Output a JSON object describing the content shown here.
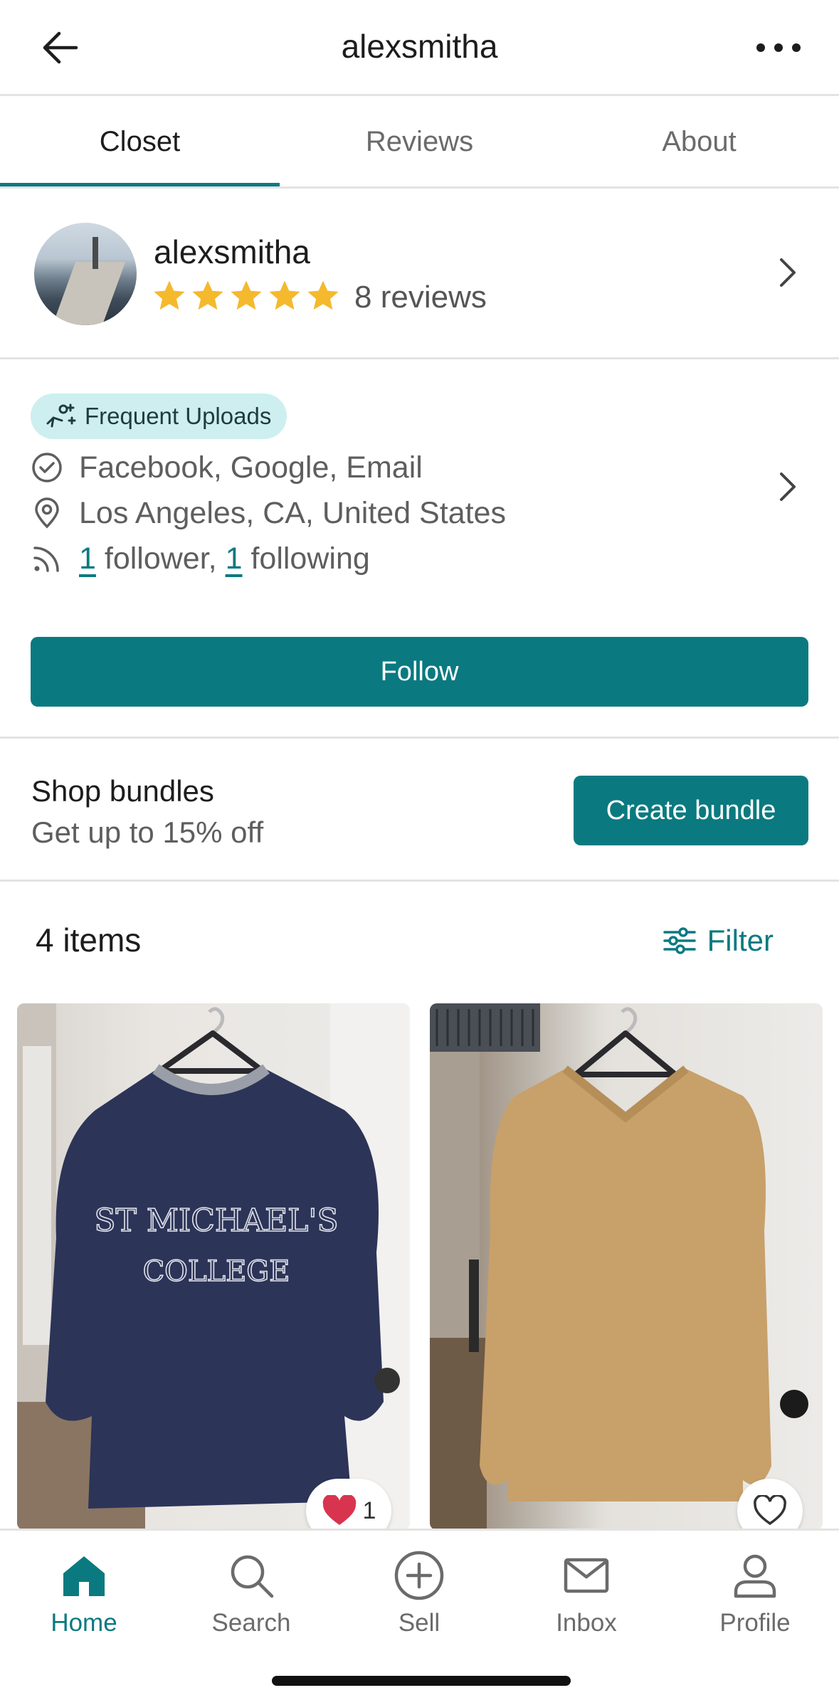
{
  "header": {
    "title": "alexsmitha",
    "back_icon": "back-arrow-icon",
    "more_icon": "more-horizontal-icon"
  },
  "tabs": [
    {
      "label": "Closet",
      "active": true
    },
    {
      "label": "Reviews",
      "active": false
    },
    {
      "label": "About",
      "active": false
    }
  ],
  "profile": {
    "username": "alexsmitha",
    "rating": 5,
    "reviews_label": "8 reviews"
  },
  "info": {
    "badge": "Frequent Uploads",
    "verified": "Facebook, Google, Email",
    "location": "Los Angeles, CA, United States",
    "followers_count": "1",
    "followers_text": "follower,",
    "following_count": "1",
    "following_text": "following"
  },
  "actions": {
    "follow_label": "Follow"
  },
  "bundles": {
    "title": "Shop bundles",
    "subtitle": "Get up to 15% off",
    "button_label": "Create bundle"
  },
  "items": {
    "count_label": "4 items",
    "filter_label": "Filter",
    "cards": [
      {
        "likes": "1",
        "liked": true,
        "print_line1": "ST MICHAEL'S",
        "print_line2": "COLLEGE"
      },
      {
        "likes": "",
        "liked": false
      }
    ]
  },
  "colors": {
    "accent": "#0a7a80",
    "star": "#f5b92e",
    "heart": "#d9344f",
    "badge_bg": "#cdeff0"
  },
  "bottom_nav": [
    {
      "label": "Home",
      "icon": "home-icon",
      "active": true
    },
    {
      "label": "Search",
      "icon": "search-icon",
      "active": false
    },
    {
      "label": "Sell",
      "icon": "plus-circle-icon",
      "active": false
    },
    {
      "label": "Inbox",
      "icon": "mail-icon",
      "active": false
    },
    {
      "label": "Profile",
      "icon": "user-icon",
      "active": false
    }
  ]
}
